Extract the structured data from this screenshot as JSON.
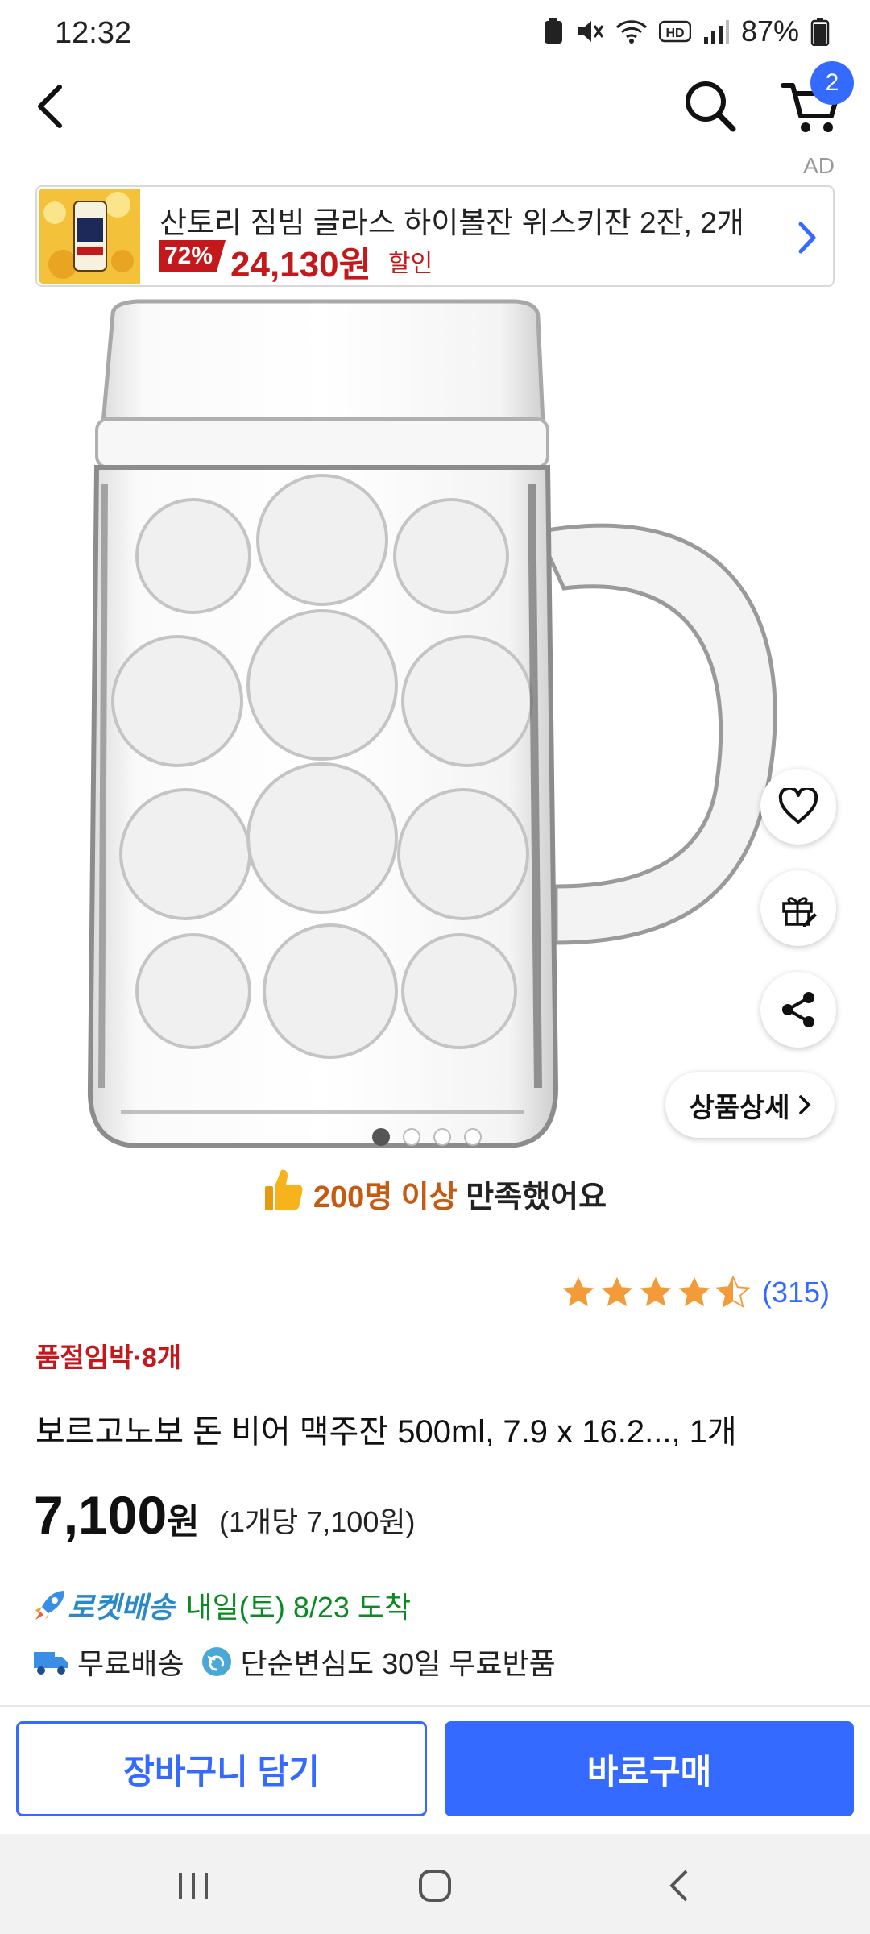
{
  "status_bar": {
    "time": "12:32",
    "battery": "87%"
  },
  "header": {
    "cart_count": "2"
  },
  "ad": {
    "label": "AD",
    "title": "산토리 짐빔 글라스 하이볼잔 위스키잔 2잔, 2개",
    "discount": "72%",
    "price": "24,130원",
    "sale_tag": "할인"
  },
  "gallery": {
    "pages": 4,
    "active_index": 0,
    "detail_label": "상품상세"
  },
  "satisfaction": {
    "highlight": "200명 이상",
    "text": " 만족했어요"
  },
  "rating": {
    "stars": 4.5,
    "count": "(315)"
  },
  "product": {
    "stock_notice": "품절임박·8개",
    "title": "보르고노보 돈 비어 맥주잔 500ml, 7.9 x 16.2..., 1개",
    "price": "7,100",
    "price_unit": "원",
    "unit_price": "(1개당 7,100원)"
  },
  "delivery": {
    "rocket_label": "로켓배송",
    "arrival": "내일(토) 8/23 도착",
    "free_shipping": "무료배송",
    "return_policy": "단순변심도 30일 무료반품"
  },
  "actions": {
    "add_to_cart": "장바구니 담기",
    "buy_now": "바로구매"
  },
  "colors": {
    "accent": "#346aff",
    "sale_red": "#c4191c",
    "arrival_green": "#0b8a24",
    "highlight_orange": "#c55a11"
  },
  "icons": [
    "back-icon",
    "search-icon",
    "cart-icon",
    "chevron-right-icon",
    "heart-icon",
    "gift-icon",
    "share-icon",
    "thumbs-up-icon",
    "star-icon",
    "rocket-icon",
    "truck-icon",
    "return-icon"
  ]
}
